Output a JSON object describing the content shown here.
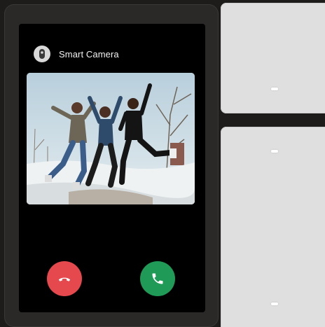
{
  "device": {
    "title": "Smart Camera",
    "camera_icon": "camera-lens-icon",
    "snapshot": "live-camera-snapshot"
  },
  "call_controls": {
    "decline_icon": "phone-hangup-icon",
    "accept_icon": "phone-icon",
    "decline_color": "#e5484d",
    "accept_color": "#1f9a57"
  },
  "wall_panels": {
    "color": "#dfdfdf",
    "indicator_color": "#ffffff"
  }
}
